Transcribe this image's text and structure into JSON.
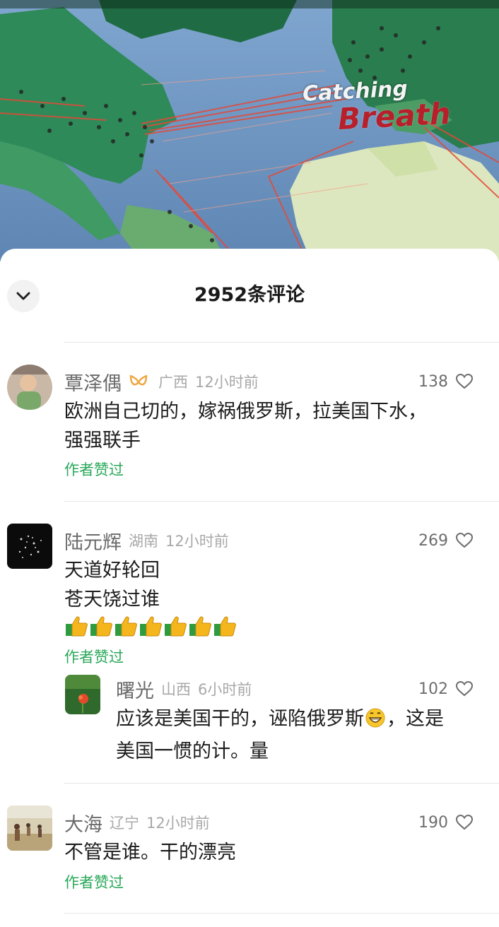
{
  "video": {
    "overlay_text_1": "Catching",
    "overlay_text_2": "Breath"
  },
  "sheet": {
    "title": "2952条评论"
  },
  "comments": [
    {
      "name": "覃泽偶",
      "location": "广西",
      "time": "12小时前",
      "likes": "138",
      "text_lines": [
        "欧洲自己切的，嫁祸俄罗斯，拉美国下水，",
        "强强联手"
      ],
      "liked_by_author": "作者赞过"
    },
    {
      "name": "陆元辉",
      "location": "湖南",
      "time": "12小时前",
      "likes": "269",
      "text_lines": [
        "天道好轮回",
        "苍天饶过谁"
      ],
      "liked_by_author": "作者赞过",
      "reply": {
        "name": "曙光",
        "location": "山西",
        "time": "6小时前",
        "likes": "102",
        "text_lines": [
          "应该是美国干的，诬陷俄罗斯",
          "，这是",
          "美国一惯的计。量"
        ]
      }
    },
    {
      "name": "大海",
      "location": "辽宁",
      "time": "12小时前",
      "likes": "190",
      "text_lines": [
        "不管是谁。干的漂亮"
      ],
      "liked_by_author": "作者赞过"
    }
  ],
  "icons": {
    "collapse": "chevron-down-icon",
    "like": "heart-outline-icon",
    "badge": "vip-badge-icon",
    "thumbs": "thumbs-up-emoji",
    "grin": "grinning-emoji"
  },
  "colors": {
    "liked_by_author": "#2aa85a",
    "badge": "#f0a640"
  }
}
